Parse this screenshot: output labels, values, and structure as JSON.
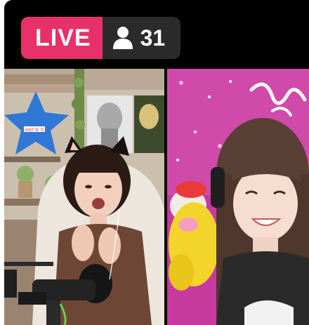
{
  "live_badge": {
    "label": "LIVE",
    "color": "#e8306a"
  },
  "viewers": {
    "icon": "person-icon",
    "count": "31"
  },
  "streams": [
    {
      "name": "guest-left",
      "poster_text": "HOT N' TI"
    },
    {
      "name": "guest-right"
    }
  ]
}
